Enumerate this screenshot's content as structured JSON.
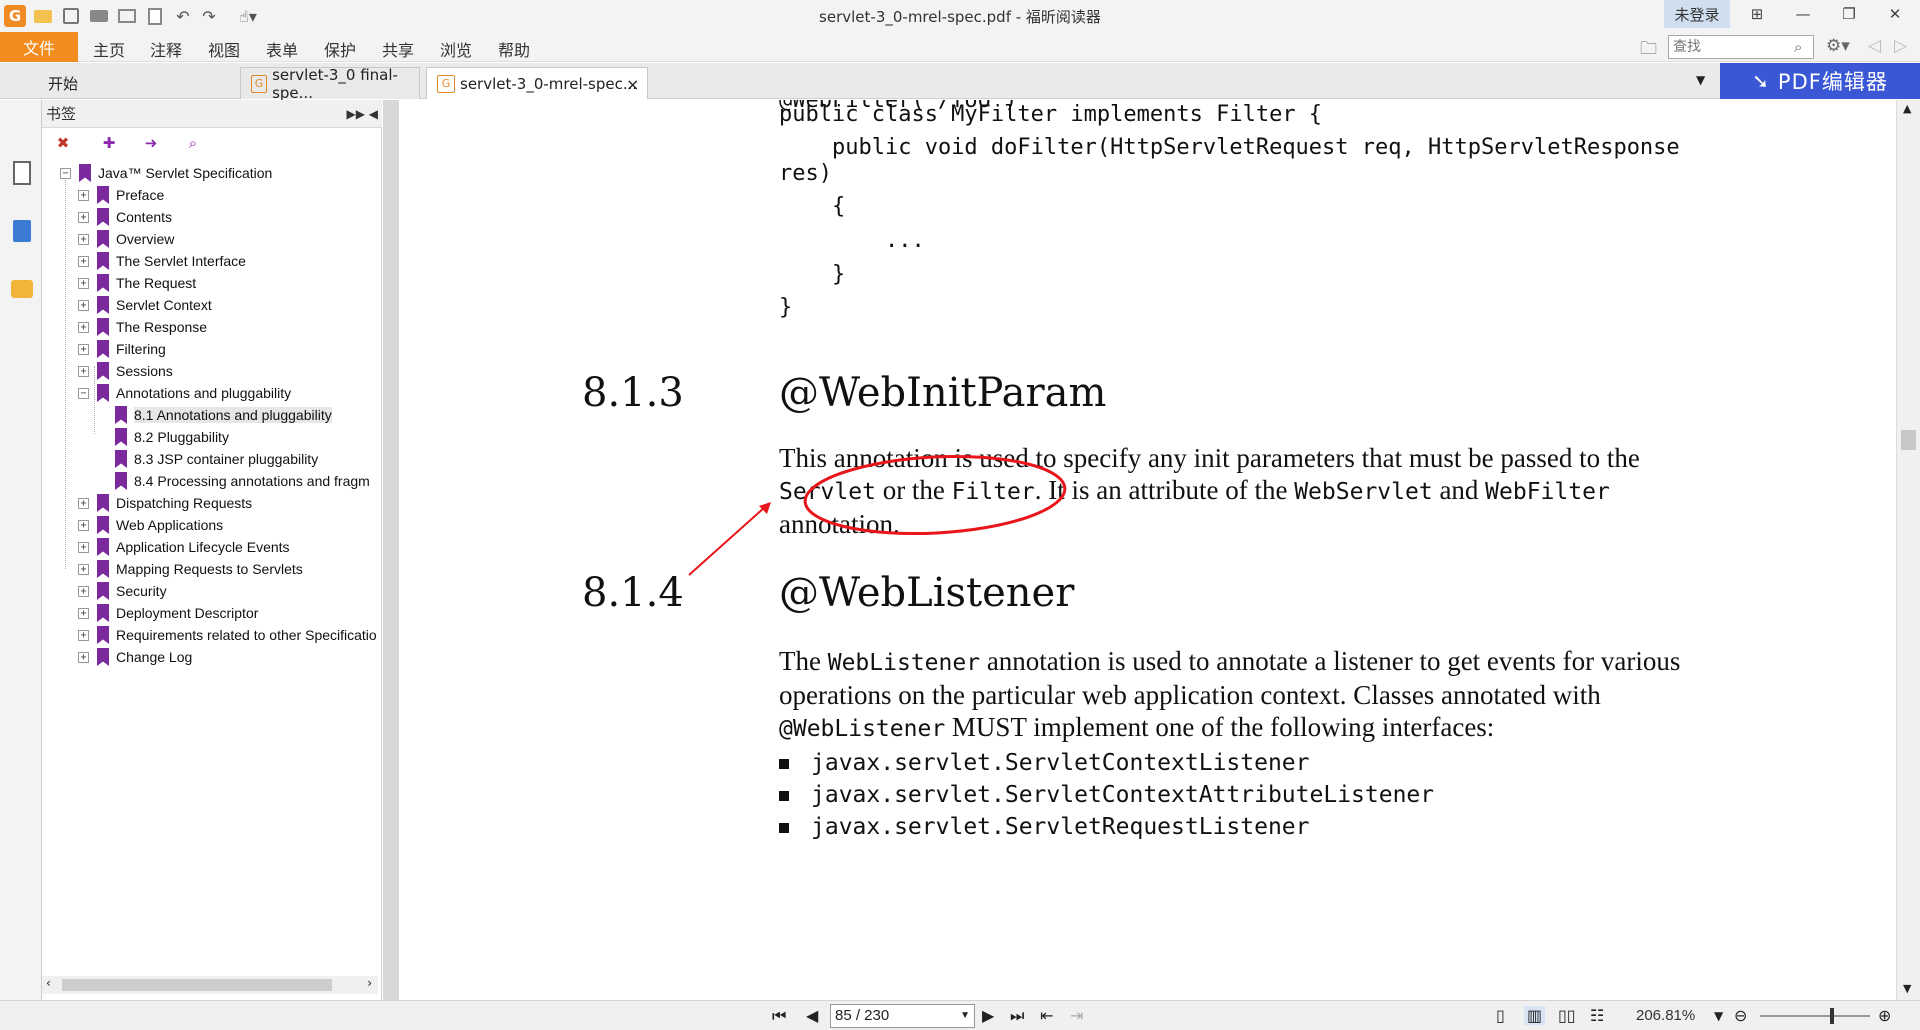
{
  "window": {
    "title": "servlet-3_0-mrel-spec.pdf - 福昕阅读器",
    "login": "未登录",
    "controls": [
      "⊞",
      "—",
      "❐",
      "✕"
    ]
  },
  "menu": {
    "file": "文件",
    "items": [
      "主页",
      "注释",
      "视图",
      "表单",
      "保护",
      "共享",
      "浏览",
      "帮助"
    ],
    "search_placeholder": "查找"
  },
  "tabs": {
    "start": "开始",
    "doc1": "servlet-3_0 final-spe...",
    "doc2": "servlet-3_0-mrel-spec...",
    "close": "×",
    "pdf_editor": "PDF编辑器"
  },
  "bookmarks": {
    "header": "书签",
    "root": "Java™ Servlet Specification",
    "items": [
      {
        "label": "Preface"
      },
      {
        "label": "Contents"
      },
      {
        "label": "Overview"
      },
      {
        "label": "The Servlet Interface"
      },
      {
        "label": "The Request"
      },
      {
        "label": "Servlet Context"
      },
      {
        "label": "The Response"
      },
      {
        "label": "Filtering"
      },
      {
        "label": "Sessions"
      },
      {
        "label": "Annotations and pluggability"
      }
    ],
    "children": [
      {
        "label": "8.1 Annotations and pluggability"
      },
      {
        "label": "8.2 Pluggability"
      },
      {
        "label": "8.3 JSP container pluggability"
      },
      {
        "label": "8.4 Processing annotations and fragm"
      }
    ],
    "items_after": [
      {
        "label": "Dispatching Requests"
      },
      {
        "label": "Web Applications"
      },
      {
        "label": "Application Lifecycle Events"
      },
      {
        "label": "Mapping Requests to Servlets"
      },
      {
        "label": "Security"
      },
      {
        "label": "Deployment Descriptor"
      },
      {
        "label": "Requirements related to other Specificatio"
      },
      {
        "label": "Change Log"
      }
    ]
  },
  "document": {
    "code_top": "@WebFilter(\"/foo\")",
    "code_lines": [
      "public class MyFilter implements Filter {",
      "    public void doFilter(HttpServletRequest req, HttpServletResponse",
      "res)",
      "    {",
      "        ...",
      "    }",
      "}"
    ],
    "section1": {
      "number": "8.1.3",
      "title": "@WebInitParam",
      "para": {
        "t1": "This annotation is used to specify any init parameters that must be passed to the",
        "m1": "Servlet",
        "t2": " or the ",
        "m2": "Filter",
        "t3": ". It is an attribute of the ",
        "m3": "WebServlet",
        "t4": " and ",
        "m4": "WebFilter",
        "t5": "annotation."
      }
    },
    "section2": {
      "number": "8.1.4",
      "title": "@WebListener",
      "para": {
        "t1": "The ",
        "m1": "WebListener",
        "t2": " annotation is used to annotate a listener to get events for various",
        "t3": "operations on the particular web application context. Classes annotated with",
        "m2": "@WebListener",
        "t4": " MUST implement one of the following interfaces:"
      },
      "bullets": [
        "javax.servlet.ServletContextListener",
        "javax.servlet.ServletContextAttributeListener",
        "javax.servlet.ServletRequestListener"
      ]
    }
  },
  "statusbar": {
    "page": "85 / 230",
    "zoom": "206.81%"
  },
  "colors": {
    "accent_orange": "#f28c1e",
    "pdf_editor_blue": "#3a58d6",
    "bookmark_purple": "#7b2a9d",
    "annotation_red": "#e8151b"
  }
}
